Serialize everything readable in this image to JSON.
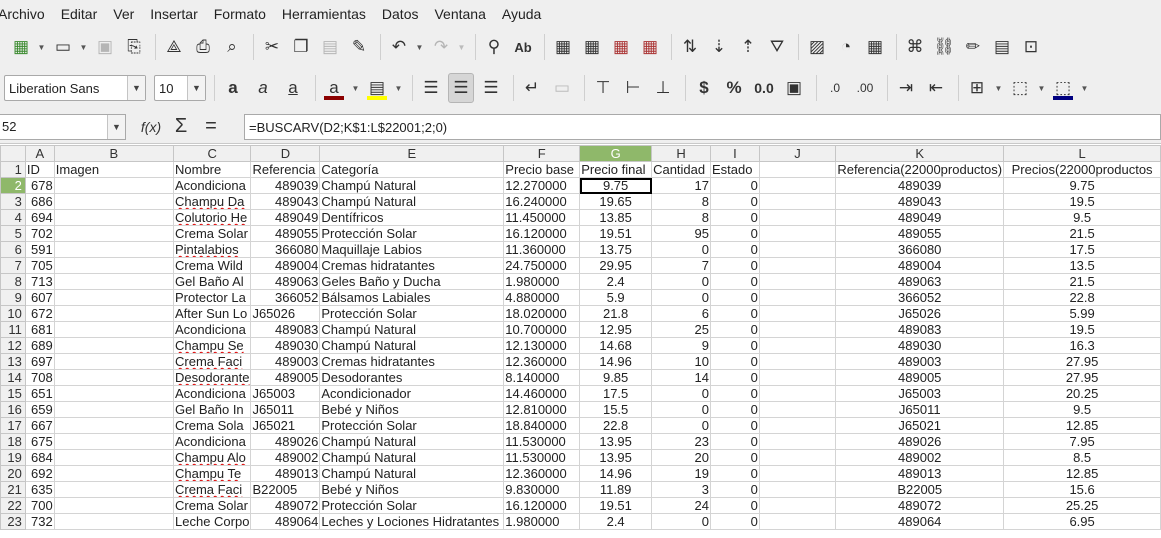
{
  "menu": [
    "Archivo",
    "Editar",
    "Ver",
    "Insertar",
    "Formato",
    "Herramientas",
    "Datos",
    "Ventana",
    "Ayuda"
  ],
  "toolbar1_icons": [
    "spreadsheet-new-icon",
    "open-folder-icon",
    "save-icon",
    "export-icon",
    "export-pdf-icon",
    "print-icon",
    "print-preview-icon",
    "cut-icon",
    "copy-icon",
    "paste-icon",
    "clone-format-icon",
    "undo-icon",
    "redo-icon",
    "find-icon",
    "spellcheck-icon",
    "row-icon",
    "column-icon",
    "insert-row-icon",
    "delete-row-icon",
    "sort-icon",
    "sort-ascending-icon",
    "sort-descending-icon",
    "autofilter-icon",
    "image-icon",
    "chart-icon",
    "pivot-table-icon",
    "special-character-icon",
    "hyperlink-icon",
    "comment-icon",
    "header-footer-icon",
    "define-print-area-icon"
  ],
  "format": {
    "font_name": "Liberation Sans",
    "font_size": "10",
    "font_color": "#8b0000",
    "highlight_color": "#ffff00",
    "border_color": "#000080"
  },
  "formula": {
    "cell_ref": "G2",
    "cell_ref_visible": "52",
    "fx_label": "f(x)",
    "sum_label": "Σ",
    "equals_label": "=",
    "content": "=BUSCARV(D2;K$1:L$22001;2;0)"
  },
  "columns": [
    "A",
    "B",
    "C",
    "D",
    "E",
    "F",
    "G",
    "H",
    "I",
    "J",
    "K",
    "L"
  ],
  "header_row": {
    "row": "1",
    "cells": [
      "ID",
      "Imagen",
      "Nombre",
      "Referencia",
      "Categoría",
      "Precio base",
      "Precio final",
      "Cantidad",
      "Estado",
      "",
      "Referencia(22000productos)",
      "Precios(22000productos"
    ]
  },
  "rows": [
    {
      "row": "2",
      "id": "678",
      "nombre": "Acondiciona",
      "ref": "489039",
      "cat": "Champú Natural",
      "base": "12.270000",
      "final": "9.75",
      "cant": "17",
      "estado": "0",
      "k": "489039",
      "l": "9.75"
    },
    {
      "row": "3",
      "id": "686",
      "nombre": "Champu Da",
      "ref": "489043",
      "cat": "Champú Natural",
      "base": "16.240000",
      "final": "19.65",
      "cant": "8",
      "estado": "0",
      "k": "489043",
      "l": "19.5"
    },
    {
      "row": "4",
      "id": "694",
      "nombre": "Colutorio He",
      "ref": "489049",
      "cat": "Dentífricos",
      "base": "11.450000",
      "final": "13.85",
      "cant": "8",
      "estado": "0",
      "k": "489049",
      "l": "9.5"
    },
    {
      "row": "5",
      "id": "702",
      "nombre": "Crema Solar",
      "ref": "489055",
      "cat": "Protección Solar",
      "base": "16.120000",
      "final": "19.51",
      "cant": "95",
      "estado": "0",
      "k": "489055",
      "l": "21.5"
    },
    {
      "row": "6",
      "id": "591",
      "nombre": "Pintalabios",
      "ref": "366080",
      "cat": "Maquillaje Labios",
      "base": "11.360000",
      "final": "13.75",
      "cant": "0",
      "estado": "0",
      "k": "366080",
      "l": "17.5"
    },
    {
      "row": "7",
      "id": "705",
      "nombre": "Crema Wild",
      "ref": "489004",
      "cat": "Cremas hidratantes",
      "base": "24.750000",
      "final": "29.95",
      "cant": "7",
      "estado": "0",
      "k": "489004",
      "l": "13.5"
    },
    {
      "row": "8",
      "id": "713",
      "nombre": "Gel Baño Al",
      "ref": "489063",
      "cat": "Geles Baño y Ducha",
      "base": "1.980000",
      "final": "2.4",
      "cant": "0",
      "estado": "0",
      "k": "489063",
      "l": "21.5"
    },
    {
      "row": "9",
      "id": "607",
      "nombre": "Protector La",
      "ref": "366052",
      "cat": "Bálsamos Labiales",
      "base": "4.880000",
      "final": "5.9",
      "cant": "0",
      "estado": "0",
      "k": "366052",
      "l": "22.8"
    },
    {
      "row": "10",
      "id": "672",
      "nombre": "After Sun Lo",
      "ref": "J65026",
      "cat": "Protección Solar",
      "base": "18.020000",
      "final": "21.8",
      "cant": "6",
      "estado": "0",
      "k": "J65026",
      "l": "5.99"
    },
    {
      "row": "11",
      "id": "681",
      "nombre": "Acondiciona",
      "ref": "489083",
      "cat": "Champú Natural",
      "base": "10.700000",
      "final": "12.95",
      "cant": "25",
      "estado": "0",
      "k": "489083",
      "l": "19.5"
    },
    {
      "row": "12",
      "id": "689",
      "nombre": "Champu Se",
      "ref": "489030",
      "cat": "Champú Natural",
      "base": "12.130000",
      "final": "14.68",
      "cant": "9",
      "estado": "0",
      "k": "489030",
      "l": "16.3"
    },
    {
      "row": "13",
      "id": "697",
      "nombre": "Crema Faci",
      "ref": "489003",
      "cat": "Cremas hidratantes",
      "base": "12.360000",
      "final": "14.96",
      "cant": "10",
      "estado": "0",
      "k": "489003",
      "l": "27.95"
    },
    {
      "row": "14",
      "id": "708",
      "nombre": "Desodorante",
      "ref": "489005",
      "cat": "Desodorantes",
      "base": "8.140000",
      "final": "9.85",
      "cant": "14",
      "estado": "0",
      "k": "489005",
      "l": "27.95"
    },
    {
      "row": "15",
      "id": "651",
      "nombre": "Acondiciona",
      "ref": "J65003",
      "cat": "Acondicionador",
      "base": "14.460000",
      "final": "17.5",
      "cant": "0",
      "estado": "0",
      "k": "J65003",
      "l": "20.25"
    },
    {
      "row": "16",
      "id": "659",
      "nombre": "Gel Baño In",
      "ref": "J65011",
      "cat": "Bebé y Niños",
      "base": "12.810000",
      "final": "15.5",
      "cant": "0",
      "estado": "0",
      "k": "J65011",
      "l": "9.5"
    },
    {
      "row": "17",
      "id": "667",
      "nombre": "Crema Sola",
      "ref": "J65021",
      "cat": "Protección Solar",
      "base": "18.840000",
      "final": "22.8",
      "cant": "0",
      "estado": "0",
      "k": "J65021",
      "l": "12.85"
    },
    {
      "row": "18",
      "id": "675",
      "nombre": "Acondiciona",
      "ref": "489026",
      "cat": "Champú Natural",
      "base": "11.530000",
      "final": "13.95",
      "cant": "23",
      "estado": "0",
      "k": "489026",
      "l": "7.95"
    },
    {
      "row": "19",
      "id": "684",
      "nombre": "Champu Alo",
      "ref": "489002",
      "cat": "Champú Natural",
      "base": "11.530000",
      "final": "13.95",
      "cant": "20",
      "estado": "0",
      "k": "489002",
      "l": "8.5"
    },
    {
      "row": "20",
      "id": "692",
      "nombre": "Champu Te",
      "ref": "489013",
      "cat": "Champú Natural",
      "base": "12.360000",
      "final": "14.96",
      "cant": "19",
      "estado": "0",
      "k": "489013",
      "l": "12.85"
    },
    {
      "row": "21",
      "id": "635",
      "nombre": "Crema Faci",
      "ref": "B22005",
      "cat": "Bebé y Niños",
      "base": "9.830000",
      "final": "11.89",
      "cant": "3",
      "estado": "0",
      "k": "B22005",
      "l": "15.6"
    },
    {
      "row": "22",
      "id": "700",
      "nombre": "Crema Solar",
      "ref": "489072",
      "cat": "Protección Solar",
      "base": "16.120000",
      "final": "19.51",
      "cant": "24",
      "estado": "0",
      "k": "489072",
      "l": "25.25"
    },
    {
      "row": "23",
      "id": "732",
      "nombre": "Leche Corpo",
      "ref": "489064",
      "cat": "Leches y Lociones Hidratantes",
      "base": "1.980000",
      "final": "2.4",
      "cant": "0",
      "estado": "0",
      "k": "489064",
      "l": "6.95"
    }
  ]
}
